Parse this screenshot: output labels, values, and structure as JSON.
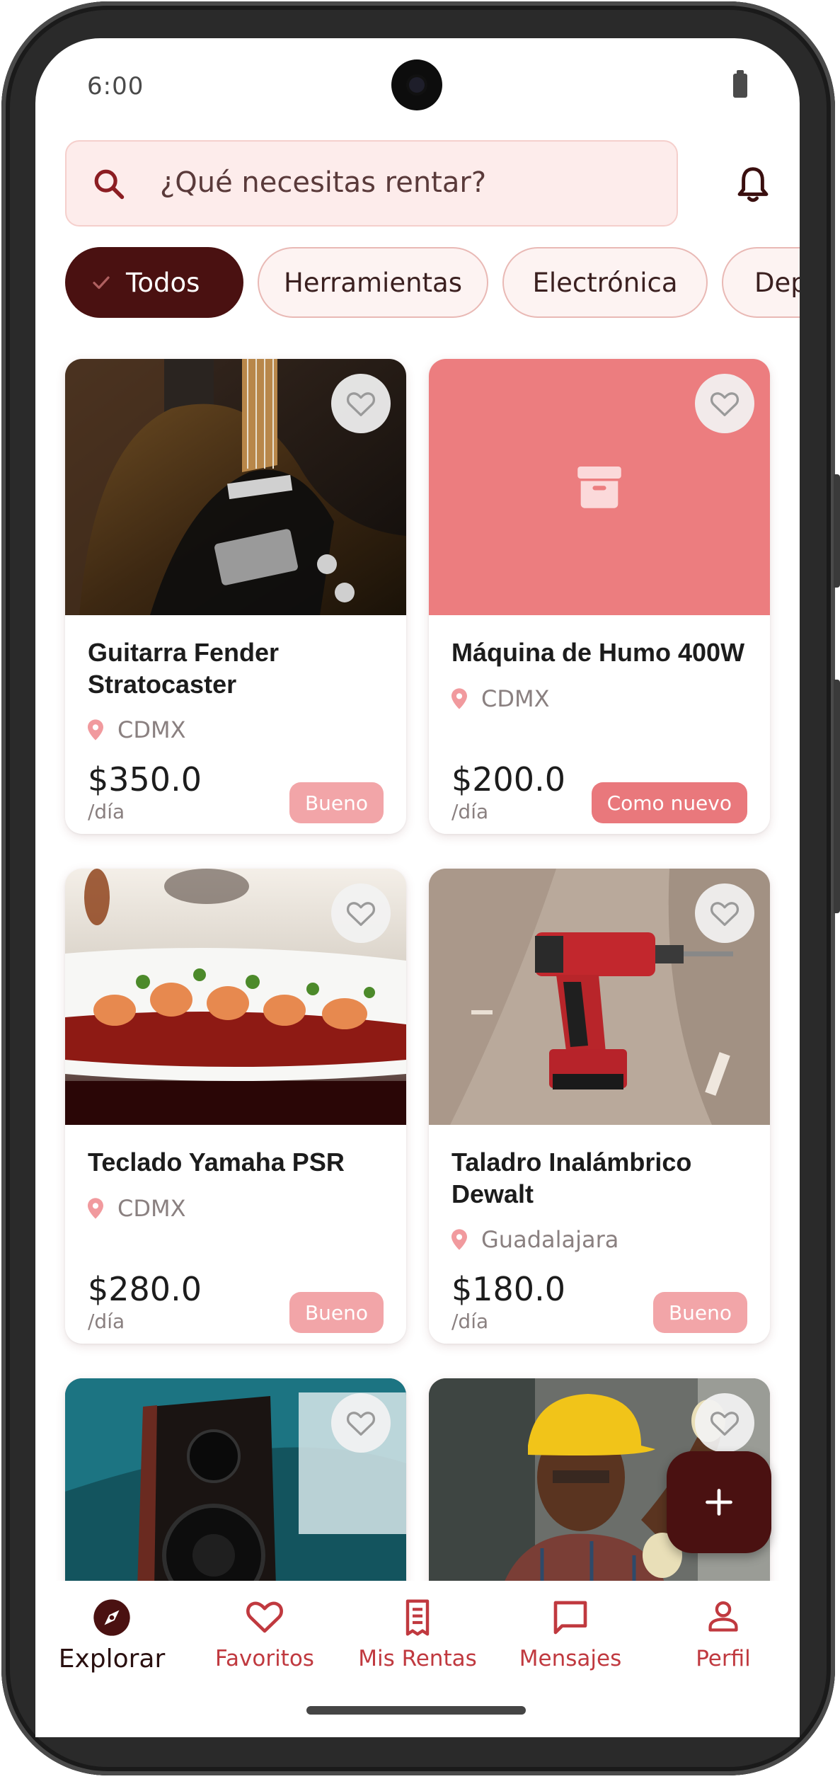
{
  "status_bar": {
    "time": "6:00"
  },
  "search": {
    "placeholder": "¿Qué necesitas rentar?"
  },
  "categories": [
    {
      "label": "Todos",
      "selected": true
    },
    {
      "label": "Herramientas",
      "selected": false
    },
    {
      "label": "Electrónica",
      "selected": false
    },
    {
      "label": "Dep",
      "selected": false
    }
  ],
  "listings": [
    {
      "title": "Guitarra Fender Stratocaster",
      "location": "CDMX",
      "price": "$350.0",
      "unit": "/día",
      "condition": "Bueno",
      "image": "guitar-photo"
    },
    {
      "title": "Máquina de Humo 400W",
      "location": "CDMX",
      "price": "$200.0",
      "unit": "/día",
      "condition": "Como nuevo",
      "image": "archive-box-placeholder-icon"
    },
    {
      "title": "Teclado Yamaha PSR",
      "location": "CDMX",
      "price": "$280.0",
      "unit": "/día",
      "condition": "Bueno",
      "image": "shrimp-dish-photo"
    },
    {
      "title": "Taladro Inalámbrico Dewalt",
      "location": "Guadalajara",
      "price": "$180.0",
      "unit": "/día",
      "condition": "Bueno",
      "image": "cordless-drill-photo"
    },
    {
      "image": "speaker-photo"
    },
    {
      "image": "construction-worker-photo"
    }
  ],
  "fab": {
    "icon": "plus-icon"
  },
  "bottom_nav": [
    {
      "label": "Explorar",
      "icon": "compass-icon",
      "active": true
    },
    {
      "label": "Favoritos",
      "icon": "heart-icon",
      "active": false
    },
    {
      "label": "Mis Rentas",
      "icon": "receipt-icon",
      "active": false
    },
    {
      "label": "Mensajes",
      "icon": "message-icon",
      "active": false
    },
    {
      "label": "Perfil",
      "icon": "person-icon",
      "active": false
    }
  ],
  "colors": {
    "primary_dark": "#4a1111",
    "accent": "#c0393f",
    "placeholder_tile": "#ec7d7f",
    "badge_soft": "#f2a5a8",
    "badge_strong": "#e9787c",
    "search_bg": "#fdeceb"
  }
}
